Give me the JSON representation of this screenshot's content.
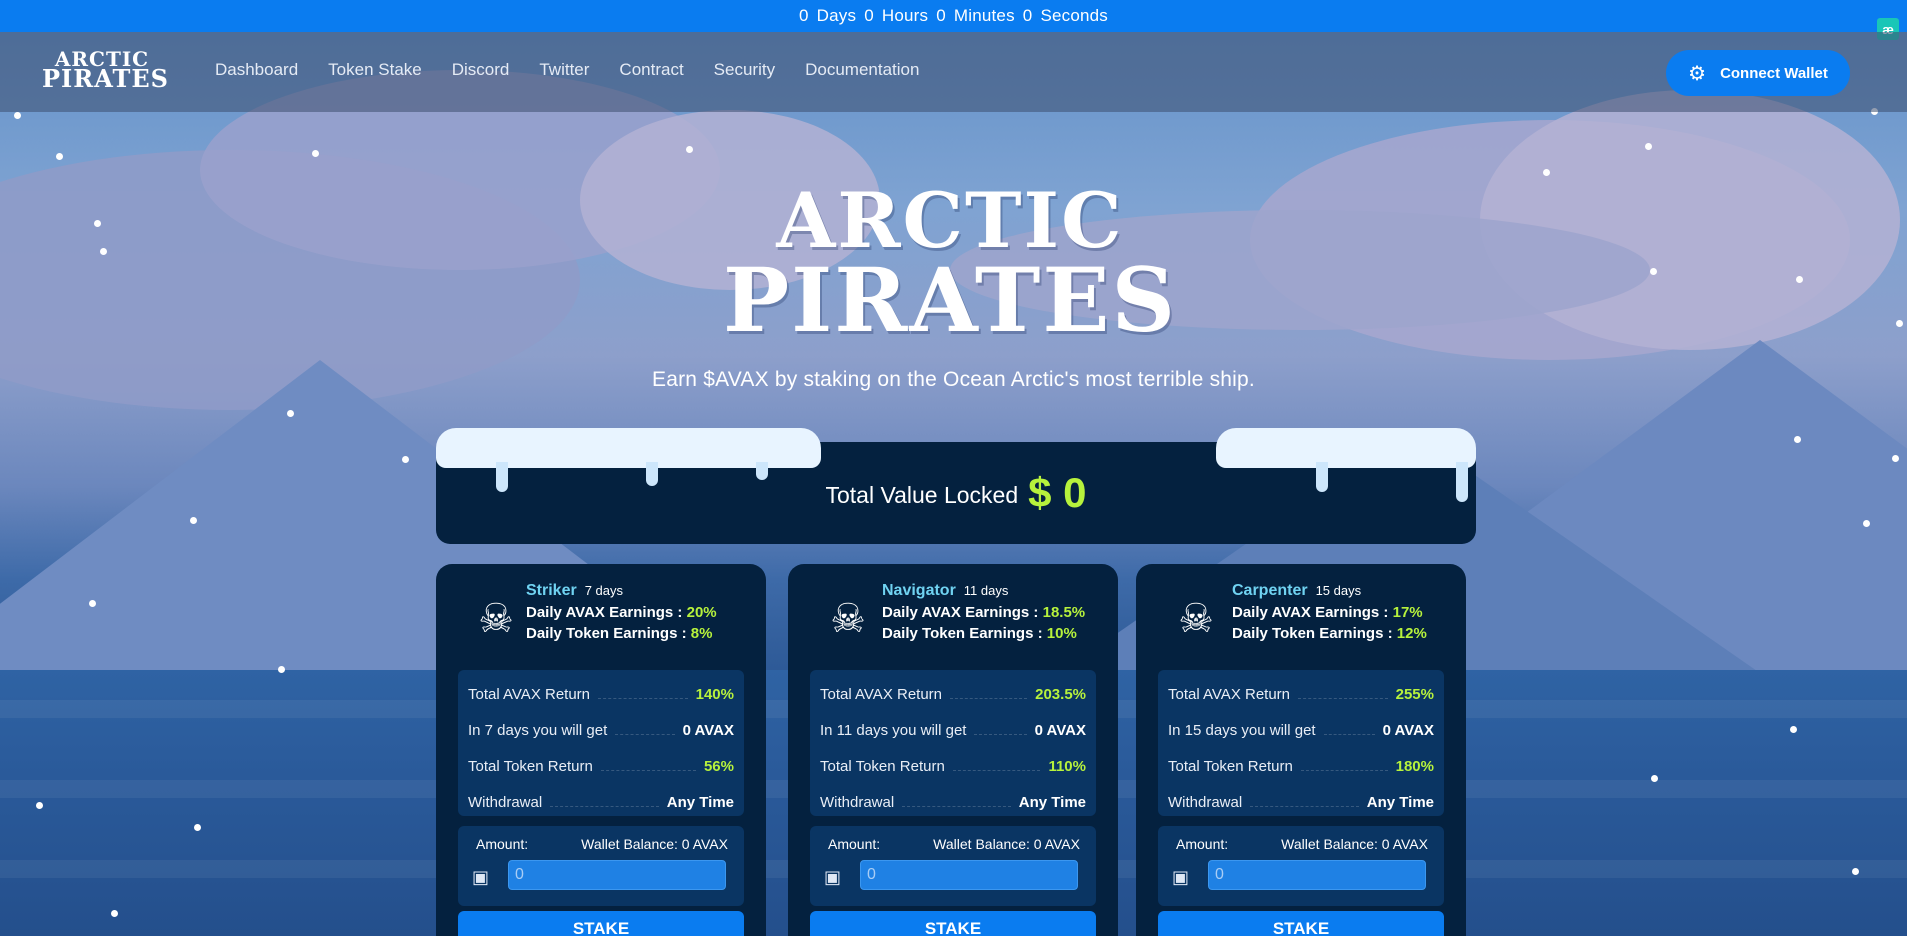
{
  "timer": {
    "days_value": "0",
    "days_label": "Days",
    "hours_value": "0",
    "hours_label": "Hours",
    "minutes_value": "0",
    "minutes_label": "Minutes",
    "seconds_value": "0",
    "seconds_label": "Seconds"
  },
  "corner_badge": "æ",
  "brand": {
    "line1": "ARCTIC",
    "line2": "PIRATES"
  },
  "nav": {
    "items": [
      "Dashboard",
      "Token Stake",
      "Discord",
      "Twitter",
      "Contract",
      "Security",
      "Documentation"
    ],
    "connect_label": "Connect Wallet"
  },
  "hero": {
    "title_line1": "ARCTIC",
    "title_line2": "PIRATES",
    "subtitle": "Earn $AVAX by staking on the Ocean Arctic's most terrible ship."
  },
  "tvl": {
    "label": "Total Value Locked",
    "value": "$ 0"
  },
  "cards": [
    {
      "name": "Striker",
      "days": "7 days",
      "avax_label": "Daily AVAX Earnings :",
      "avax_value": "20%",
      "token_label": "Daily Token Earnings :",
      "token_value": "8%",
      "rows": [
        {
          "label": "Total AVAX Return",
          "value": "140%"
        },
        {
          "label": "In 7 days you will get",
          "value": "0 AVAX"
        },
        {
          "label": "Total Token Return",
          "value": "56%"
        },
        {
          "label": "Withdrawal",
          "value": "Any Time"
        }
      ],
      "amount_label": "Amount:",
      "wallet_balance": "Wallet Balance: 0 AVAX",
      "amount_value": "0",
      "stake_label": "STAKE"
    },
    {
      "name": "Navigator",
      "days": "11 days",
      "avax_label": "Daily AVAX Earnings :",
      "avax_value": "18.5%",
      "token_label": "Daily Token Earnings :",
      "token_value": "10%",
      "rows": [
        {
          "label": "Total AVAX Return",
          "value": "203.5%"
        },
        {
          "label": "In 11 days you will get",
          "value": "0 AVAX"
        },
        {
          "label": "Total Token Return",
          "value": "110%"
        },
        {
          "label": "Withdrawal",
          "value": "Any Time"
        }
      ],
      "amount_label": "Amount:",
      "wallet_balance": "Wallet Balance: 0 AVAX",
      "amount_value": "0",
      "stake_label": "STAKE"
    },
    {
      "name": "Carpenter",
      "days": "15 days",
      "avax_label": "Daily AVAX Earnings :",
      "avax_value": "17%",
      "token_label": "Daily Token Earnings :",
      "token_value": "12%",
      "rows": [
        {
          "label": "Total AVAX Return",
          "value": "255%"
        },
        {
          "label": "In 15 days you will get",
          "value": "0 AVAX"
        },
        {
          "label": "Total Token Return",
          "value": "180%"
        },
        {
          "label": "Withdrawal",
          "value": "Any Time"
        }
      ],
      "amount_label": "Amount:",
      "wallet_balance": "Wallet Balance: 0 AVAX",
      "amount_value": "0",
      "stake_label": "STAKE"
    }
  ],
  "icons": {
    "card_avatar": "pirate-skull-icon",
    "amount": "treasure-chest-icon",
    "connect": "gear-icon"
  },
  "colors": {
    "primary_blue": "#0a7cf0",
    "card_bg": "#04213f",
    "accent_green": "#b7f23c",
    "name_cyan": "#70d3f2"
  }
}
